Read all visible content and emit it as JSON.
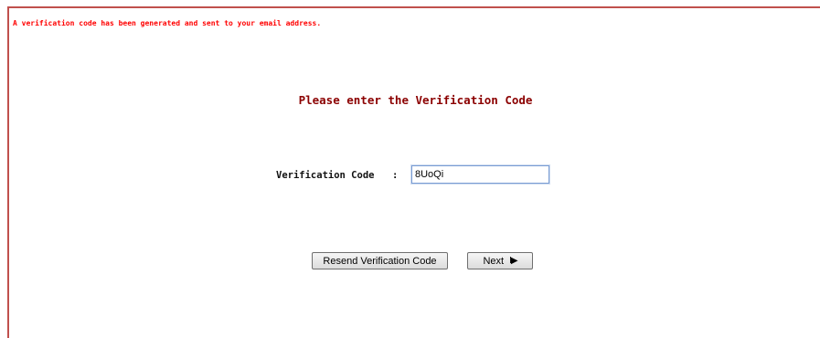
{
  "notice": "A verification code has been generated and sent to your email address.",
  "heading": "Please enter the Verification Code",
  "form": {
    "label": "Verification Code",
    "separator": ":",
    "code_value": "8UoQi"
  },
  "buttons": {
    "resend_label": "Resend Verification Code",
    "next_label": "Next",
    "next_icon": "I▶"
  },
  "colors": {
    "notice": "#ff0000",
    "heading": "#8b0000",
    "frame_border": "#c0504d"
  }
}
